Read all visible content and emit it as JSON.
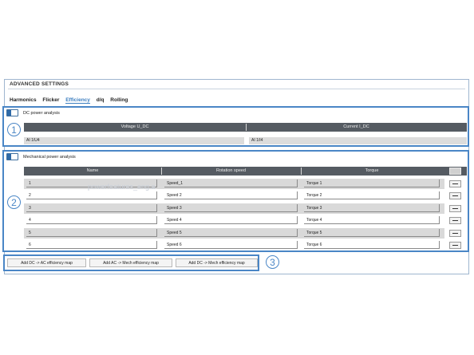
{
  "window": {
    "title": "ADVANCED SETTINGS"
  },
  "tabs": [
    {
      "label": "Harmonics",
      "active": false
    },
    {
      "label": "Flicker",
      "active": false
    },
    {
      "label": "Efficiency",
      "active": true
    },
    {
      "label": "d/q",
      "active": false
    },
    {
      "label": "Rolling",
      "active": false
    }
  ],
  "dc_section": {
    "label": "DC power analysis",
    "enabled": true,
    "headers": [
      "Voltage U_DC",
      "Current I_DC"
    ],
    "values": [
      "AI 1/U4",
      "AI 1/I4"
    ]
  },
  "mech_section": {
    "label": "Mechanical power analysis",
    "enabled": true,
    "headers": [
      "Name",
      "Rotation speed",
      "Torque"
    ],
    "rows": [
      {
        "name": "1",
        "speed": "Speed_1",
        "torque": "Torque 1"
      },
      {
        "name": "2",
        "speed": "Speed 2",
        "torque": "Torque 2"
      },
      {
        "name": "3",
        "speed": "Speed 3",
        "torque": "Torque 3"
      },
      {
        "name": "4",
        "speed": "Speed 4",
        "torque": "Torque 4"
      },
      {
        "name": "5",
        "speed": "Speed  5",
        "torque": "Torque 5"
      },
      {
        "name": "6",
        "speed": "Speed 6",
        "torque": "Torque 6"
      }
    ]
  },
  "buttons": [
    "Add DC -> AC efficiency map",
    "Add AC -> Mech efficiency map",
    "Add DC -> Mech efficiency map"
  ],
  "callouts": [
    "1",
    "2",
    "3"
  ],
  "watermark": "powerfeatures_eng.a",
  "colors": {
    "accent": "#4a86c6",
    "header_bg": "#555b62",
    "tab_active": "#3d7fc0"
  }
}
